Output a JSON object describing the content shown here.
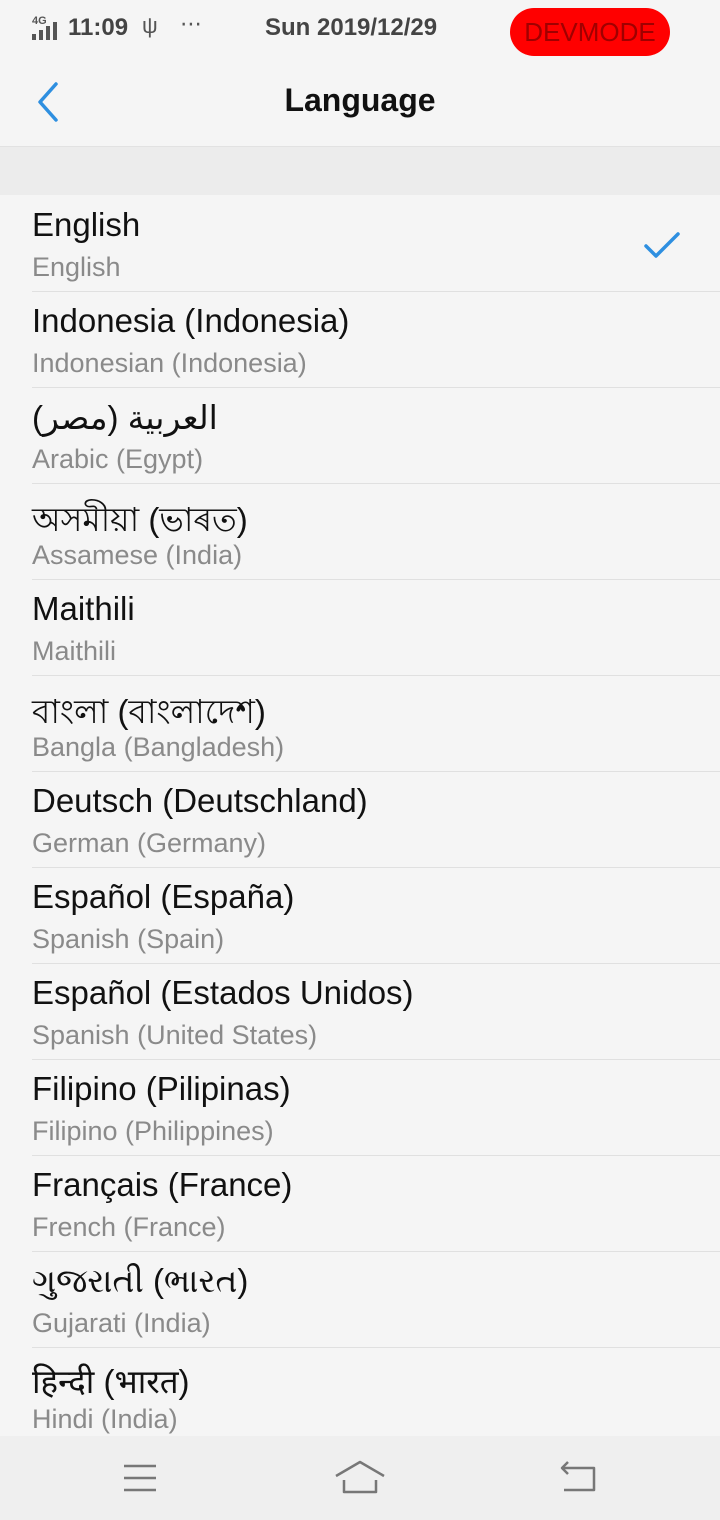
{
  "status_bar": {
    "network": "4G",
    "time": "11:09",
    "usb_icon": "usb-icon",
    "more_icon": "⋯",
    "date": "Sun 2019/12/29",
    "devmode": "DEVMODE"
  },
  "header": {
    "title": "Language",
    "back_icon": "back-chevron-icon"
  },
  "languages": [
    {
      "native": "English",
      "english": "English",
      "selected": true
    },
    {
      "native": "Indonesia (Indonesia)",
      "english": "Indonesian (Indonesia)"
    },
    {
      "native": "العربية (مصر)",
      "english": "Arabic (Egypt)"
    },
    {
      "native": "অসমীয়া (ভাৰত)",
      "english": "Assamese (India)"
    },
    {
      "native": "Maithili",
      "english": "Maithili"
    },
    {
      "native": "বাংলা (বাংলাদেশ)",
      "english": "Bangla (Bangladesh)"
    },
    {
      "native": "Deutsch (Deutschland)",
      "english": "German (Germany)"
    },
    {
      "native": "Español (España)",
      "english": "Spanish (Spain)"
    },
    {
      "native": "Español (Estados Unidos)",
      "english": "Spanish (United States)"
    },
    {
      "native": "Filipino (Pilipinas)",
      "english": "Filipino (Philippines)"
    },
    {
      "native": "Français (France)",
      "english": "French (France)"
    },
    {
      "native": "ગુજરાતી (ભારત)",
      "english": "Gujarati (India)"
    },
    {
      "native": "हिन्दी (भारत)",
      "english": "Hindi (India)"
    }
  ],
  "nav_bar": {
    "menu_icon": "menu-icon",
    "home_icon": "home-icon",
    "back_icon": "back-icon"
  },
  "colors": {
    "accent": "#2e8fe0",
    "devmode_bg": "#ff0000"
  }
}
